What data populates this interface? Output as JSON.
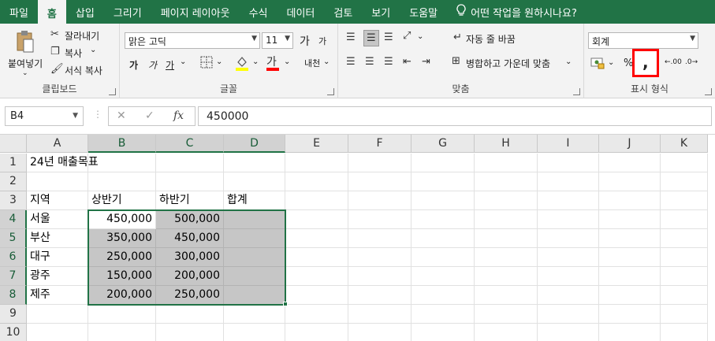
{
  "tabs": [
    "파일",
    "홈",
    "삽입",
    "그리기",
    "페이지 레이아웃",
    "수식",
    "데이터",
    "검토",
    "보기",
    "도움말"
  ],
  "active_tab": "홈",
  "tell_me": "어떤 작업을 원하시나요?",
  "clipboard": {
    "paste": "붙여넣기",
    "cut": "잘라내기",
    "copy": "복사",
    "format_painter": "서식 복사",
    "label": "클립보드"
  },
  "font": {
    "name": "맑은 고딕",
    "size": "11",
    "label": "글꼴",
    "grow": "가",
    "shrink": "가",
    "bold": "가",
    "italic": "가",
    "underline": "가",
    "font_color_glyph": "가",
    "phonetic": "내천"
  },
  "alignment": {
    "wrap_text": "자동 줄 바꿈",
    "merge_center": "병합하고 가운데 맞춤",
    "label": "맞춤"
  },
  "number": {
    "format": "회계",
    "percent": "%",
    "comma": ",",
    "increase_decimal": ".00",
    "decrease_decimal": ".0",
    "label": "표시 형식"
  },
  "colors": {
    "accent": "#217346",
    "highlight_box": "#ff0000",
    "selection_fill": "#c6c6c6"
  },
  "formula_bar": {
    "name_box": "B4",
    "fx": "fx",
    "value": "450000"
  },
  "columns": [
    "A",
    "B",
    "C",
    "D",
    "E",
    "F",
    "G",
    "H",
    "I",
    "J",
    "K"
  ],
  "rows": [
    "1",
    "2",
    "3",
    "4",
    "5",
    "6",
    "7",
    "8",
    "9",
    "10"
  ],
  "sheet": {
    "title": "24년 매출목표",
    "headers": [
      "지역",
      "상반기",
      "하반기",
      "합계"
    ],
    "data": [
      [
        "서울",
        "450,000",
        "500,000",
        ""
      ],
      [
        "부산",
        "350,000",
        "450,000",
        ""
      ],
      [
        "대구",
        "250,000",
        "300,000",
        ""
      ],
      [
        "광주",
        "150,000",
        "200,000",
        ""
      ],
      [
        "제주",
        "200,000",
        "250,000",
        ""
      ]
    ]
  }
}
